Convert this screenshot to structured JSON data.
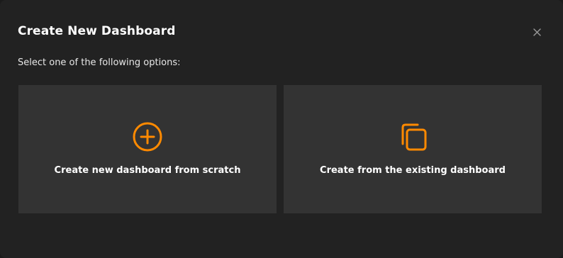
{
  "dialog": {
    "title": "Create New Dashboard",
    "close_icon": "close-icon",
    "subtitle": "Select one of the following options:"
  },
  "options": [
    {
      "label": "Create new dashboard from scratch",
      "icon": "plus-circle-icon"
    },
    {
      "label": "Create from the existing dashboard",
      "icon": "copy-icon"
    }
  ],
  "colors": {
    "accent": "#ff8a00",
    "background": "#222222",
    "card": "#333333",
    "text": "#ffffff",
    "muted_icon": "#9a9a9a"
  }
}
